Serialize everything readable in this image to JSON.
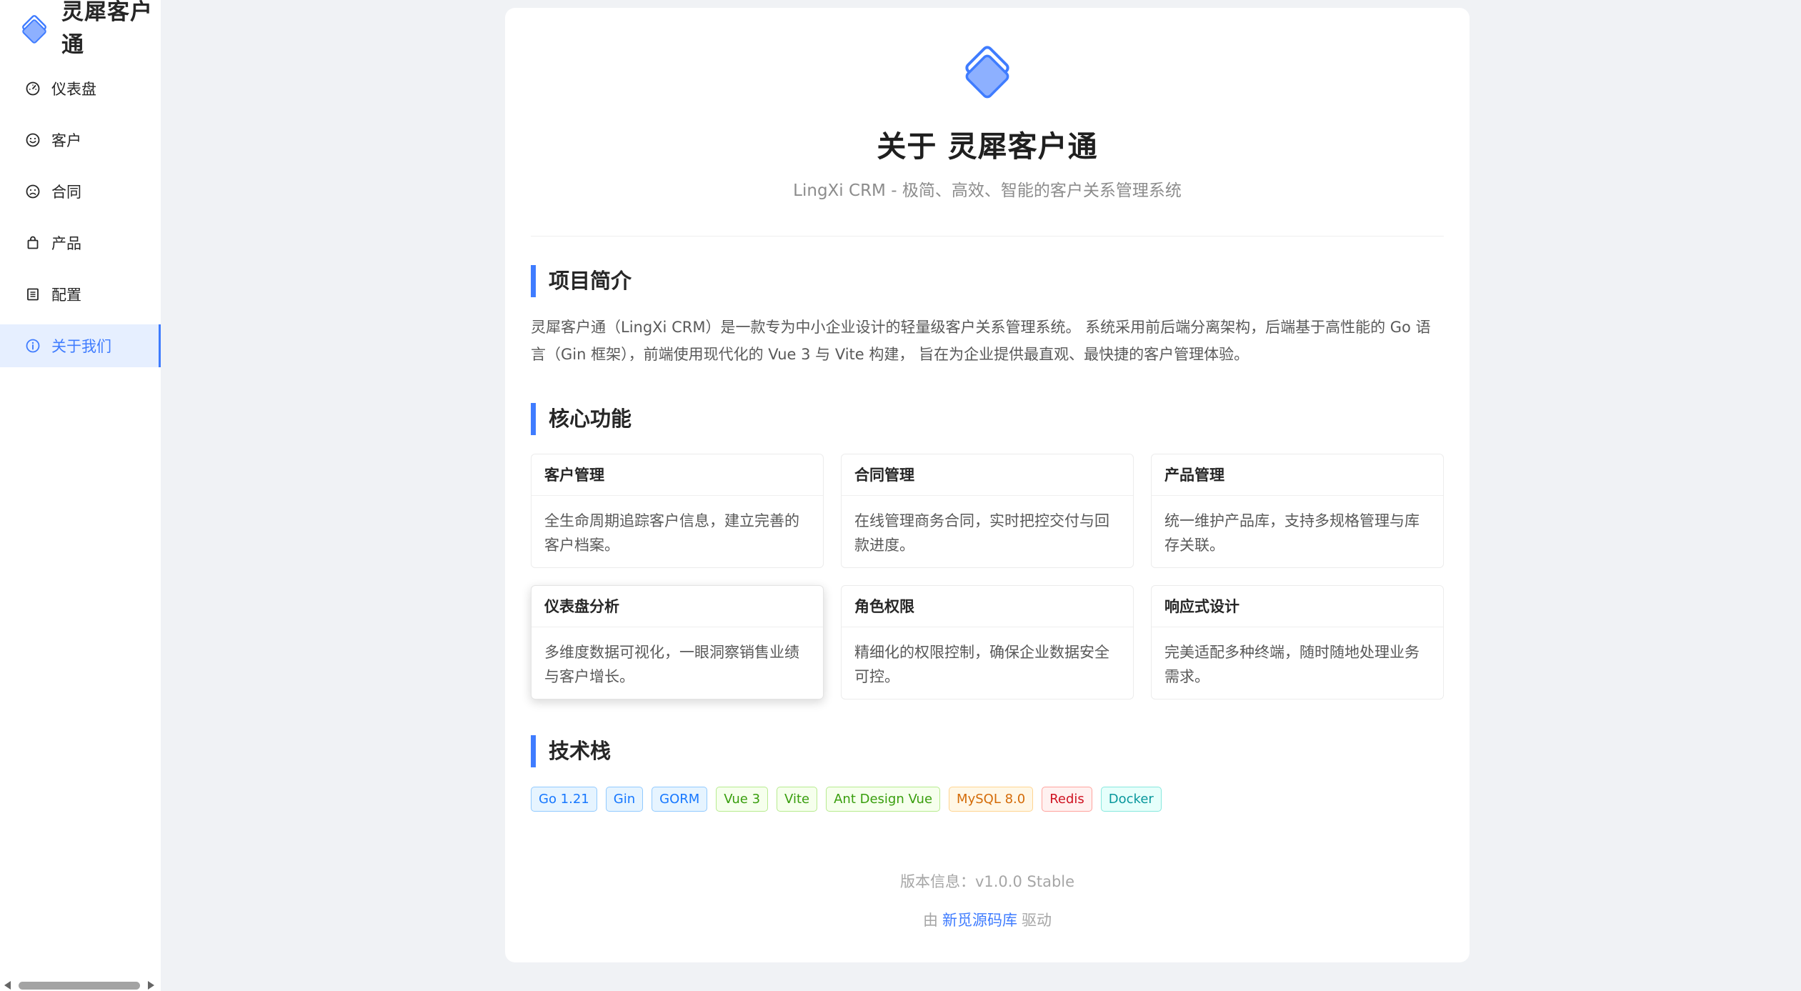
{
  "brand": {
    "name": "灵犀客户通",
    "logo_icon": "diamond-logo-icon",
    "accent_color": "#3f7cff"
  },
  "sidebar": {
    "items": [
      {
        "label": "仪表盘",
        "icon": "dashboard-icon",
        "active": false
      },
      {
        "label": "客户",
        "icon": "smile-icon",
        "active": false
      },
      {
        "label": "合同",
        "icon": "frown-icon",
        "active": false
      },
      {
        "label": "产品",
        "icon": "shopping-bag-icon",
        "active": false
      },
      {
        "label": "配置",
        "icon": "list-icon",
        "active": false
      },
      {
        "label": "关于我们",
        "icon": "info-icon",
        "active": true
      }
    ]
  },
  "about": {
    "title_prefix": "关于",
    "title_name": "灵犀客户通",
    "subtitle": "LingXi CRM - 极简、高效、智能的客户关系管理系统",
    "intro": {
      "heading": "项目简介",
      "text": "灵犀客户通（LingXi CRM）是一款专为中小企业设计的轻量级客户关系管理系统。 系统采用前后端分离架构，后端基于高性能的 Go 语言（Gin 框架），前端使用现代化的 Vue 3 与 Vite 构建， 旨在为企业提供最直观、最快捷的客户管理体验。"
    },
    "features": {
      "heading": "核心功能",
      "items": [
        {
          "title": "客户管理",
          "desc": "全生命周期追踪客户信息，建立完善的客户档案。"
        },
        {
          "title": "合同管理",
          "desc": "在线管理商务合同，实时把控交付与回款进度。"
        },
        {
          "title": "产品管理",
          "desc": "统一维护产品库，支持多规格管理与库存关联。"
        },
        {
          "title": "仪表盘分析",
          "desc": "多维度数据可视化，一眼洞察销售业绩与客户增长。"
        },
        {
          "title": "角色权限",
          "desc": "精细化的权限控制，确保企业数据安全可控。"
        },
        {
          "title": "响应式设计",
          "desc": "完美适配多种终端，随时随地处理业务需求。"
        }
      ]
    },
    "tech": {
      "heading": "技术栈",
      "tags": [
        {
          "label": "Go 1.21",
          "color": "blue"
        },
        {
          "label": "Gin",
          "color": "blue"
        },
        {
          "label": "GORM",
          "color": "blue"
        },
        {
          "label": "Vue 3",
          "color": "green"
        },
        {
          "label": "Vite",
          "color": "green"
        },
        {
          "label": "Ant Design Vue",
          "color": "green"
        },
        {
          "label": "MySQL 8.0",
          "color": "orange"
        },
        {
          "label": "Redis",
          "color": "red"
        },
        {
          "label": "Docker",
          "color": "cyan"
        }
      ]
    },
    "version": {
      "label": "版本信息：",
      "value": "v1.0.0 Stable"
    },
    "powered": {
      "prefix": "由",
      "link": "新觅源码库",
      "suffix": "驱动"
    }
  }
}
